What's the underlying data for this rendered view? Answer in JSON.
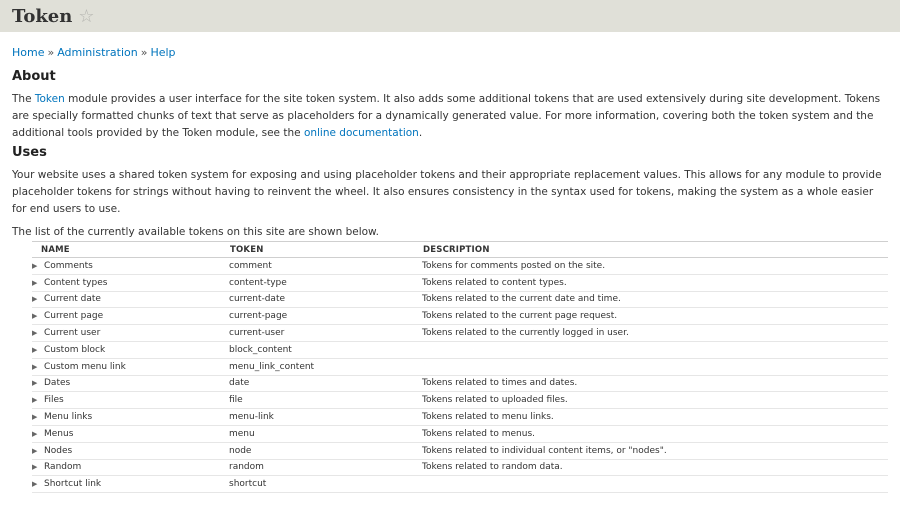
{
  "header": {
    "title": "Token",
    "star_icon": "star-icon"
  },
  "breadcrumb": [
    "Home",
    "Administration",
    "Help"
  ],
  "breadcrumb_separator": "»",
  "about": {
    "heading": "About",
    "text_1": "The ",
    "link_token": "Token",
    "text_2": " module provides a user interface for the site token system. It also adds some additional tokens that are used extensively during site development. Tokens are specially formatted chunks of text that serve as placeholders for a dynamically generated value. For more information, covering both the token system and the additional tools provided by the Token module, see the ",
    "link_docs": "online documentation",
    "text_3": "."
  },
  "uses": {
    "heading": "Uses",
    "text": "Your website uses a shared token system for exposing and using placeholder tokens and their appropriate replacement values. This allows for any module to provide placeholder tokens for strings without having to reinvent the wheel. It also ensures consistency in the syntax used for tokens, making the system as a whole easier for end users to use.",
    "list_intro": "The list of the currently available tokens on this site are shown below."
  },
  "table": {
    "headers": [
      "NAME",
      "TOKEN",
      "DESCRIPTION"
    ],
    "rows": [
      {
        "name": "Comments",
        "token": "comment",
        "desc": "Tokens for comments posted on the site."
      },
      {
        "name": "Content types",
        "token": "content-type",
        "desc": "Tokens related to content types."
      },
      {
        "name": "Current date",
        "token": "current-date",
        "desc": "Tokens related to the current date and time."
      },
      {
        "name": "Current page",
        "token": "current-page",
        "desc": "Tokens related to the current page request."
      },
      {
        "name": "Current user",
        "token": "current-user",
        "desc": "Tokens related to the currently logged in user."
      },
      {
        "name": "Custom block",
        "token": "block_content",
        "desc": ""
      },
      {
        "name": "Custom menu link",
        "token": "menu_link_content",
        "desc": ""
      },
      {
        "name": "Dates",
        "token": "date",
        "desc": "Tokens related to times and dates."
      },
      {
        "name": "Files",
        "token": "file",
        "desc": "Tokens related to uploaded files."
      },
      {
        "name": "Menu links",
        "token": "menu-link",
        "desc": "Tokens related to menu links."
      },
      {
        "name": "Menus",
        "token": "menu",
        "desc": "Tokens related to menus."
      },
      {
        "name": "Nodes",
        "token": "node",
        "desc": "Tokens related to individual content items, or \"nodes\"."
      },
      {
        "name": "Random",
        "token": "random",
        "desc": "Tokens related to random data."
      },
      {
        "name": "Shortcut link",
        "token": "shortcut",
        "desc": ""
      }
    ]
  }
}
